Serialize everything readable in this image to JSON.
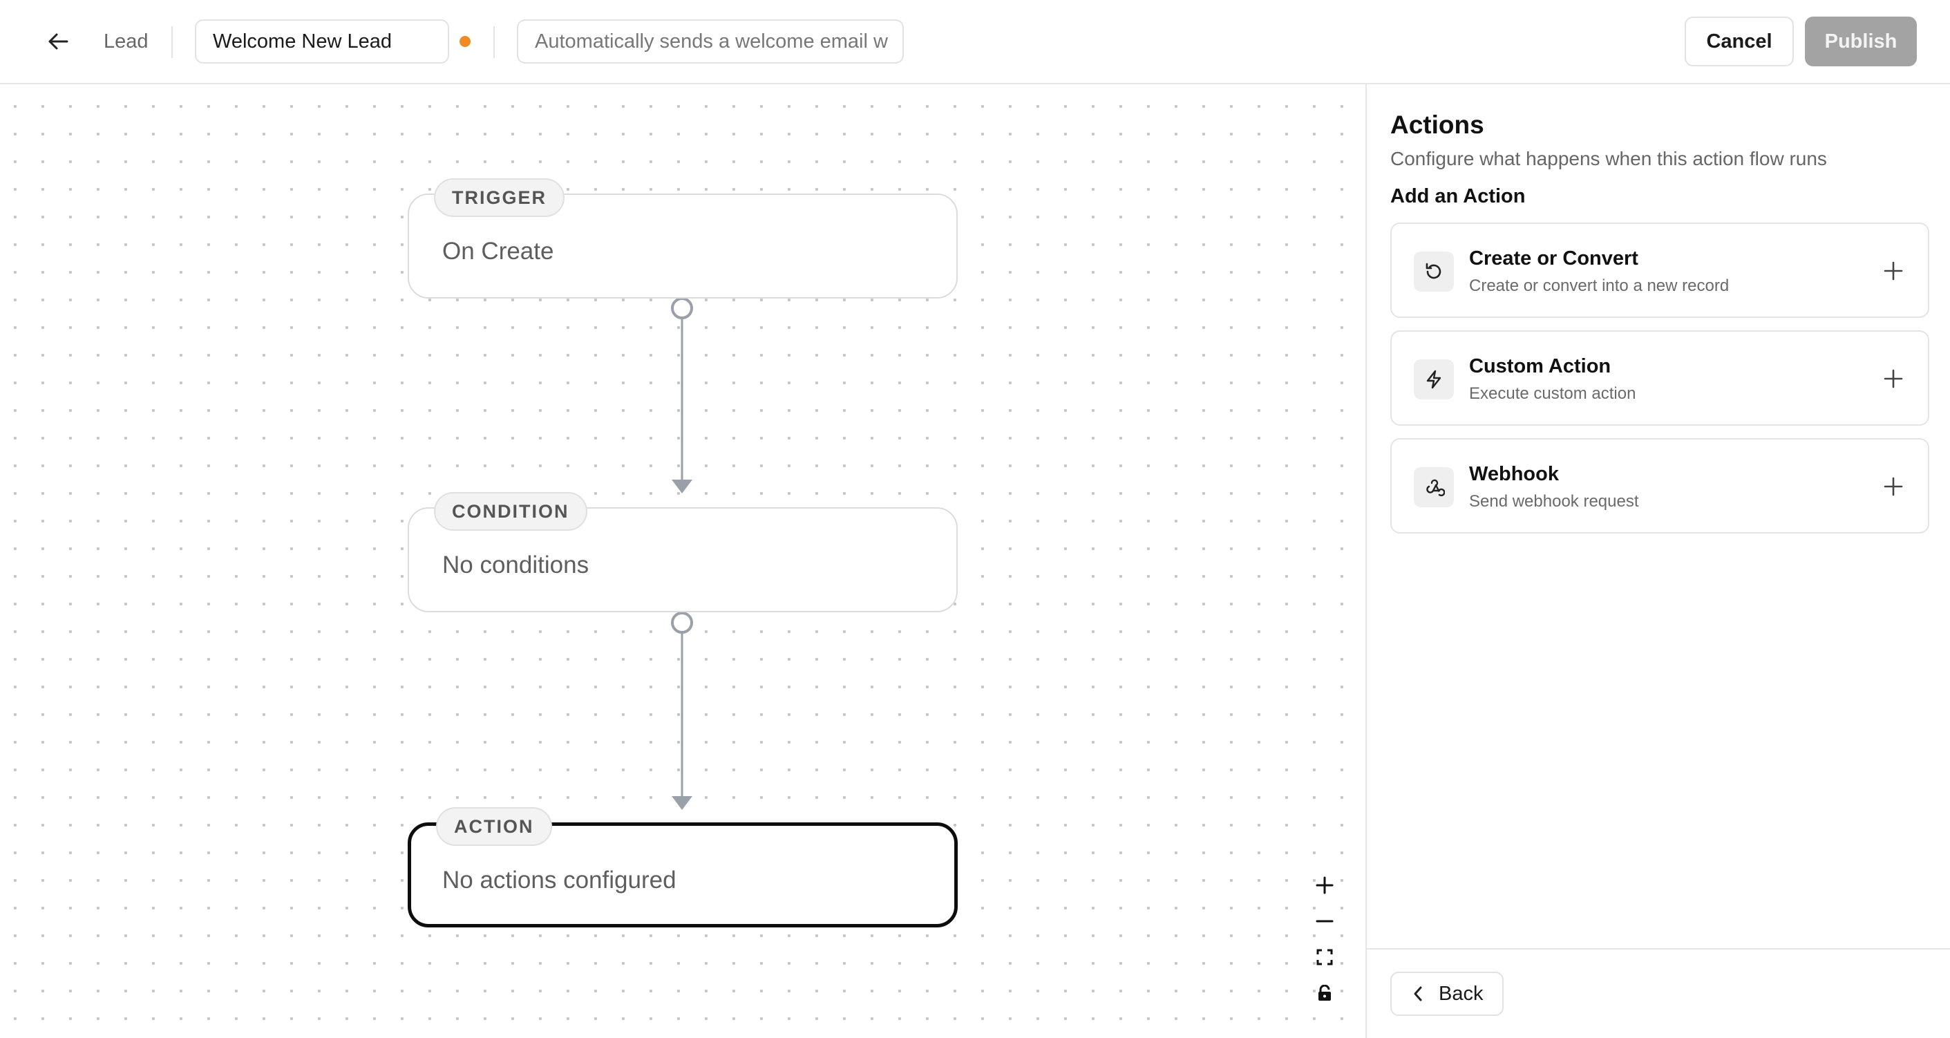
{
  "header": {
    "back_icon": "arrow-left-icon",
    "entity": "Lead",
    "flow_name": "Welcome New Lead",
    "unsaved_color": "#f08a24",
    "description_value": "Automatically sends a welcome email w",
    "cancel_label": "Cancel",
    "publish_label": "Publish"
  },
  "canvas": {
    "nodes": [
      {
        "badge": "TRIGGER",
        "text": "On Create"
      },
      {
        "badge": "CONDITION",
        "text": "No conditions"
      },
      {
        "badge": "ACTION",
        "text": "No actions configured",
        "selected": true
      }
    ],
    "controls": [
      "zoom-in-icon",
      "zoom-out-icon",
      "fit-view-icon",
      "lock-icon"
    ]
  },
  "panel": {
    "title": "Actions",
    "subtitle": "Configure what happens when this action flow runs",
    "section_label": "Add an Action",
    "actions": [
      {
        "name": "Create or Convert",
        "description": "Create or convert into a new record",
        "icon": "rotate-ccw-icon"
      },
      {
        "name": "Custom Action",
        "description": "Execute custom action",
        "icon": "zap-icon"
      },
      {
        "name": "Webhook",
        "description": "Send webhook request",
        "icon": "webhook-icon"
      }
    ],
    "back_label": "Back"
  }
}
